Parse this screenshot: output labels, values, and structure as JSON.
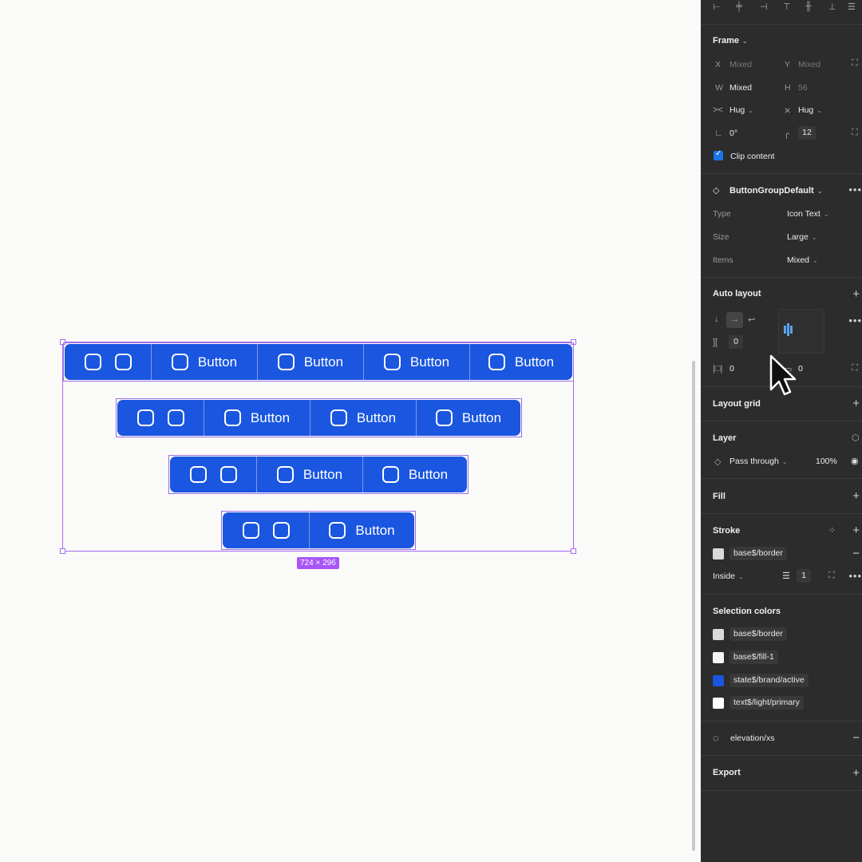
{
  "canvas": {
    "groups": [
      {
        "segments": [
          {
            "type": "icons"
          },
          {
            "type": "text",
            "label": "Button"
          },
          {
            "type": "text",
            "label": "Button"
          },
          {
            "type": "text",
            "label": "Button"
          },
          {
            "type": "text",
            "label": "Button"
          }
        ]
      },
      {
        "segments": [
          {
            "type": "icons"
          },
          {
            "type": "text",
            "label": "Button"
          },
          {
            "type": "text",
            "label": "Button"
          },
          {
            "type": "text",
            "label": "Button"
          }
        ]
      },
      {
        "segments": [
          {
            "type": "icons"
          },
          {
            "type": "text",
            "label": "Button"
          },
          {
            "type": "text",
            "label": "Button"
          }
        ]
      },
      {
        "segments": [
          {
            "type": "icons"
          },
          {
            "type": "text",
            "label": "Button"
          }
        ]
      }
    ],
    "size_badge": "724 × 296",
    "button_color": "#1a56e0",
    "selection_color": "#a56bf0"
  },
  "panel": {
    "frame": {
      "title": "Frame",
      "x_label": "X",
      "x_value": "Mixed",
      "y_label": "Y",
      "y_value": "Mixed",
      "w_label": "W",
      "w_value": "Mixed",
      "h_label": "H",
      "h_value": "56",
      "hug_h": "Hug",
      "hug_v": "Hug",
      "rotation": "0°",
      "radius": "12",
      "clip_content": "Clip content"
    },
    "component": {
      "name": "ButtonGroupDefault",
      "props": [
        {
          "label": "Type",
          "value": "Icon Text"
        },
        {
          "label": "Size",
          "value": "Large"
        },
        {
          "label": "Items",
          "value": "Mixed"
        }
      ]
    },
    "auto_layout": {
      "title": "Auto layout",
      "gap": "0",
      "padding_h": "0",
      "padding_v": "0"
    },
    "layout_grid": {
      "title": "Layout grid"
    },
    "layer": {
      "title": "Layer",
      "blend": "Pass through",
      "opacity": "100%"
    },
    "fill": {
      "title": "Fill"
    },
    "stroke": {
      "title": "Stroke",
      "color_name": "base$/border",
      "position": "Inside",
      "weight": "1"
    },
    "selection_colors": {
      "title": "Selection colors",
      "items": [
        {
          "name": "base$/border",
          "color": "#d9d9d9"
        },
        {
          "name": "base$/fill-1",
          "color": "#f5f5f5"
        },
        {
          "name": "state$/brand/active",
          "color": "#1a56e0"
        },
        {
          "name": "text$/light/primary",
          "color": "#ffffff"
        }
      ]
    },
    "effect": {
      "name": "elevation/xs"
    },
    "export": {
      "title": "Export"
    }
  }
}
